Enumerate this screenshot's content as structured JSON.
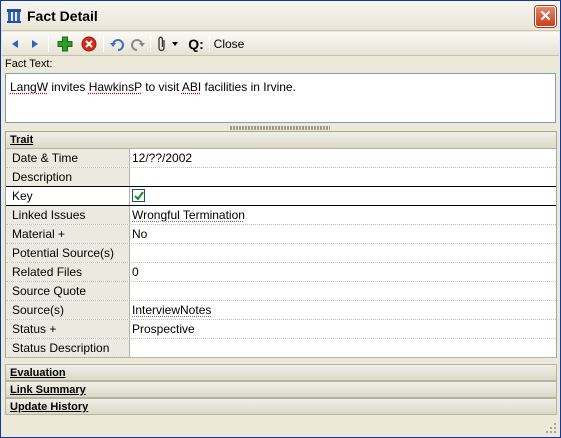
{
  "window": {
    "title": "Fact Detail",
    "close_glyph": "✕"
  },
  "toolbar": {
    "icons": [
      "back-arrow-icon",
      "forward-arrow-icon",
      "add-icon",
      "delete-icon",
      "undo-icon",
      "redo-icon",
      "attachment-icon",
      "dropdown-caret-icon",
      "query-icon"
    ],
    "query_label": "Q:",
    "close_label": "Close"
  },
  "fact_text": {
    "label": "Fact Text:",
    "parts": [
      "LangW",
      " invites ",
      "HawkinsP",
      " to visit ",
      "ABI",
      " facilities in Irvine."
    ]
  },
  "trait": {
    "header": "Trait",
    "rows": [
      {
        "label": "Date & Time",
        "value": "12/??/2002"
      },
      {
        "label": "Description",
        "value": ""
      },
      {
        "label": "Key",
        "value": "",
        "checked": true
      },
      {
        "label": "Linked Issues",
        "value": "Wrongful Termination"
      },
      {
        "label": "Material +",
        "value": "No"
      },
      {
        "label": "Potential Source(s)",
        "value": ""
      },
      {
        "label": "Related Files",
        "value": "0"
      },
      {
        "label": "Source Quote",
        "value": ""
      },
      {
        "label": "Source(s)",
        "value": "InterviewNotes"
      },
      {
        "label": "Status +",
        "value": "Prospective"
      },
      {
        "label": "Status Description",
        "value": ""
      }
    ]
  },
  "sections": {
    "evaluation": "Evaluation",
    "link_summary": "Link Summary",
    "update_history": "Update History"
  },
  "colors": {
    "add": "#2e9e2a",
    "delete": "#d52a1a",
    "nav": "#2b62c8",
    "check": "#1c8a1c"
  }
}
